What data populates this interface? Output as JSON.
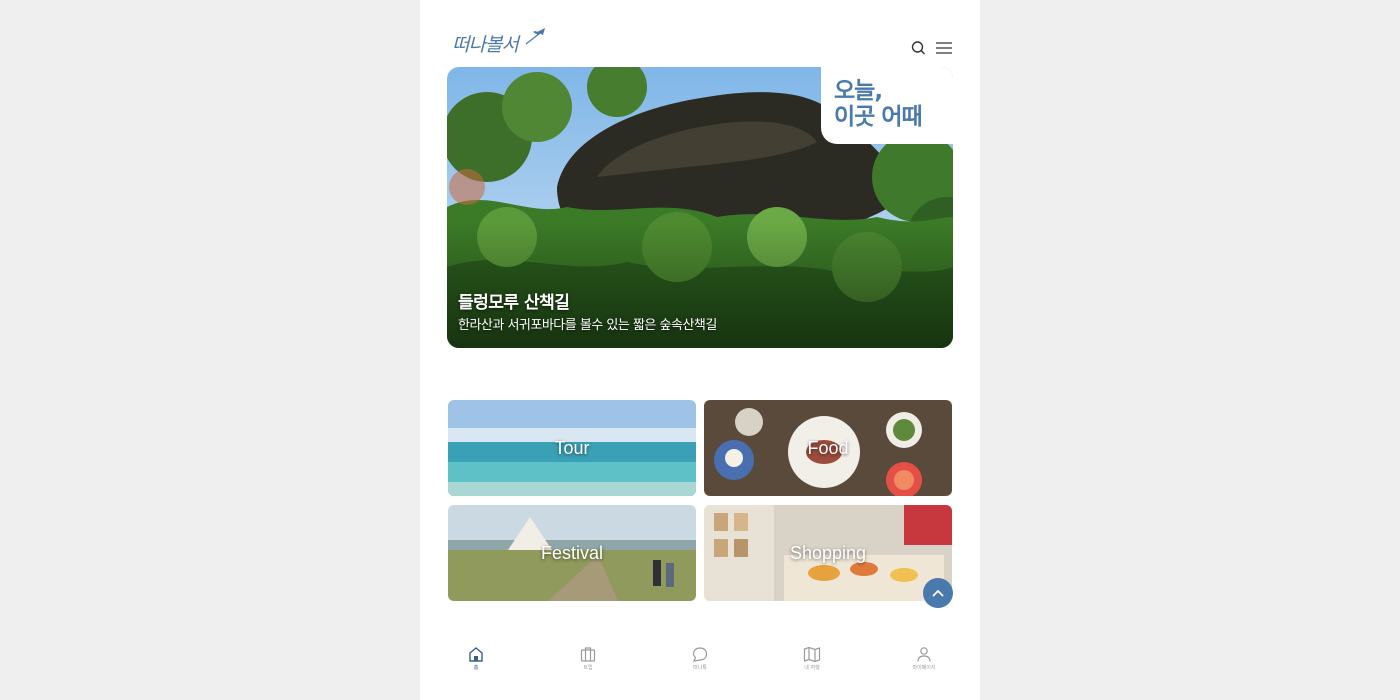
{
  "header": {
    "logo_text": "떠나볼서",
    "search_icon": "search-icon",
    "menu_icon": "hamburger-menu-icon"
  },
  "hero": {
    "tagline_line1": "오늘,",
    "tagline_line2": "이곳 어때",
    "title": "들렁모루 산책길",
    "subtitle": "한라산과 서귀포바다를 볼수 있는 짧은 숲속산책길"
  },
  "categories": [
    {
      "label": "Tour"
    },
    {
      "label": "Food"
    },
    {
      "label": "Festival"
    },
    {
      "label": "Shopping"
    }
  ],
  "bottom_nav": [
    {
      "label": "홈",
      "icon": "home-icon",
      "active": true
    },
    {
      "label": "트립",
      "icon": "suitcase-icon",
      "active": false
    },
    {
      "label": "떠나톡",
      "icon": "chat-bubble-icon",
      "active": false
    },
    {
      "label": "내 여행",
      "icon": "map-icon",
      "active": false
    },
    {
      "label": "마이페이지",
      "icon": "user-icon",
      "active": false
    }
  ],
  "colors": {
    "accent": "#4a79ae",
    "page_bg": "#efefef",
    "app_bg": "#ffffff"
  }
}
